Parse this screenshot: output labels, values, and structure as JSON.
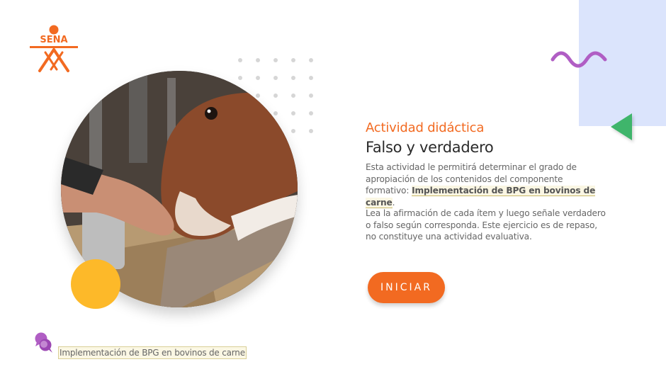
{
  "brand": {
    "logo_text": "SENA",
    "logo_color": "#f26a21"
  },
  "activity": {
    "pre_title": "Actividad didáctica",
    "title": "Falso y verdadero",
    "description_prefix": "Esta actividad le permitirá determinar el grado de apropiación de los contenidos del componente formativo:",
    "component_name": "Implementación de  BPG en bovinos de carne",
    "description_suffix": ".",
    "instructions": "Lea la afirmación de cada ítem y luego señale verdadero o falso según corresponda.  Este ejercicio es de repaso, no constituye una actividad evaluativa."
  },
  "start_button": {
    "label": "INICIAR"
  },
  "footer": {
    "label": "Implementación de  BPG en bovinos de carne"
  },
  "icons": {
    "logo": "sena-logo-icon",
    "wave": "wave-decoration-icon",
    "triangle": "triangle-decoration-icon",
    "footer": "chat-bubbles-icon"
  },
  "colors": {
    "accent": "#f26a21",
    "blue_panel": "#dbe4fc",
    "green_triangle": "#3fb56b",
    "yellow_circle": "#fdb929",
    "purple": "#b05ec4"
  }
}
